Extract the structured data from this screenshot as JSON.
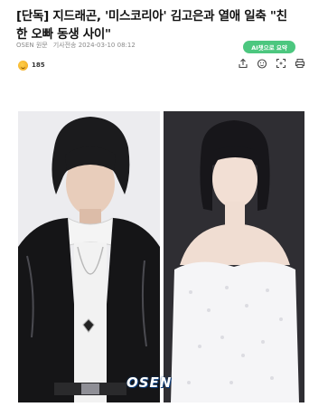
{
  "article": {
    "headline": "[단독] 지드래곤, '미스코리아' 김고은과 열애 일축 \"친한 오빠 동생 사이\"",
    "source": "OSEN 원문",
    "date_label": "기사전송 2024-03-10 08:12",
    "ai_summary_label": "AI챗으로 요약",
    "reaction_count": "185",
    "photo_watermark": "OSEN"
  },
  "toolbar": {
    "icons": [
      "share-icon",
      "emoji-icon",
      "fullscreen-icon",
      "print-icon"
    ]
  },
  "colors": {
    "ai_badge": "#4cc77f",
    "text": "#111111",
    "meta": "#8a8a8a"
  }
}
